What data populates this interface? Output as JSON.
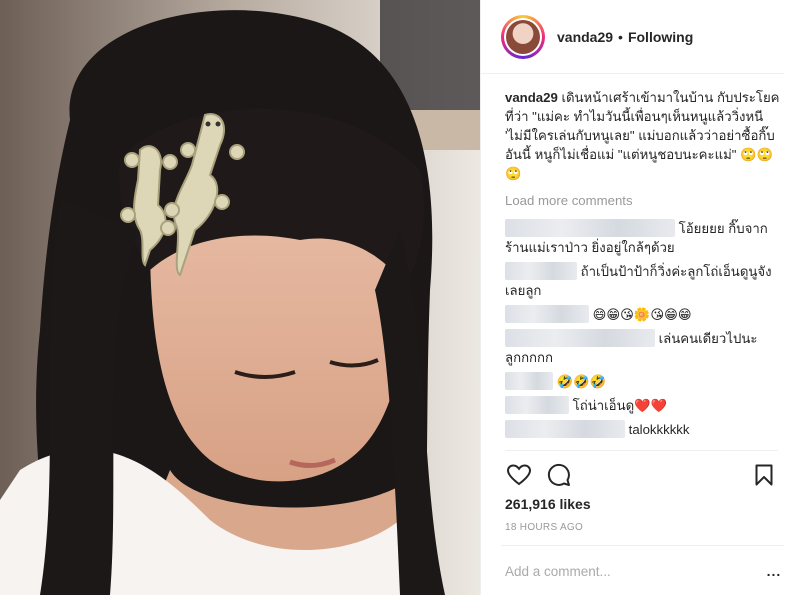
{
  "post": {
    "username": "vanda29",
    "separator": "•",
    "follow_status": "Following"
  },
  "caption": {
    "author": "vanda29",
    "text": "เดินหน้าเศร้าเข้ามาในบ้าน กับประโยคที่ว่า \"แม่คะ ทำไมวันนี้เพื่อนๆเห็นหนูแล้ววิ่งหนี 'ไม่มีใครเล่นกับหนูเลย\" แม่บอกแล้วว่าอย่าซื้อกิ๊บอันนี้ หนูก็ไม่เชื่อแม่ \"แต่หนูชอบนะคะแม่\" 🙄🙄🙄"
  },
  "load_more": "Load more comments",
  "comments": [
    {
      "text": "โอ้ยยยย กิ๊บจากร้านแม่เราป่าว ยิ่งอยู่ใกล้ๆด้วย"
    },
    {
      "text": "ถ้าเป็นป้าป้าก็วิ่งค่ะลูกโถ่เอ็นดูนูจังเลยลูก"
    },
    {
      "text": "😄😁😘🌼😘😁😁"
    },
    {
      "text": "เล่นคนเดียวไปนะลูกกกกก"
    },
    {
      "text": "🤣🤣🤣"
    },
    {
      "text": "โถ่น่าเอ็นดู❤️❤️"
    },
    {
      "text": "talokkkkkk"
    }
  ],
  "actions": {
    "like_icon": "heart-outline-icon",
    "comment_icon": "speech-bubble-icon",
    "save_icon": "bookmark-icon"
  },
  "likes": "261,916 likes",
  "timestamp": "18 HOURS AGO",
  "add_comment": {
    "placeholder": "Add a comment...",
    "more_label": "..."
  }
}
